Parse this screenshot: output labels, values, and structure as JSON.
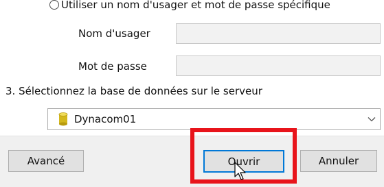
{
  "auth": {
    "specific_credentials_option": "Utiliser un nom d'usager et mot de passe spécifique",
    "username_label": "Nom d'usager",
    "username_value": "",
    "password_label": "Mot de passe",
    "password_value": ""
  },
  "database": {
    "section_label": "3. Sélectionnez la base de données sur le serveur",
    "selected_value": "Dynacom01",
    "icon": "database-icon"
  },
  "buttons": {
    "advanced_label": "Avancé",
    "open_label": "Ouvrir",
    "cancel_label": "Annuler"
  },
  "colors": {
    "highlight": "#e8141b",
    "focus_border": "#0078d7",
    "database_icon": "#d4b81c"
  }
}
